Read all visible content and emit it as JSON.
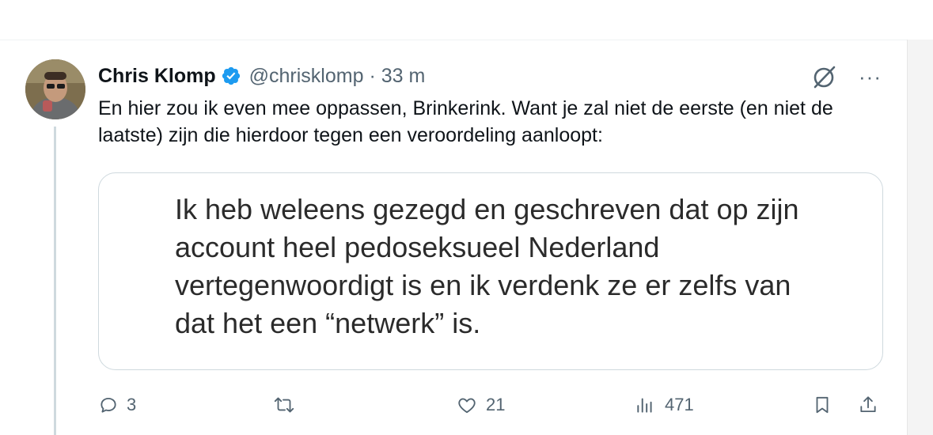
{
  "author": {
    "name": "Chris Klomp",
    "handle": "@chrisklomp",
    "separator": "·",
    "time": "33 m"
  },
  "tweet": {
    "text": "En hier zou ik even mee oppassen, Brinkerink. Want je zal niet de eerste (en niet de laatste) zijn die hierdoor tegen een veroordeling aanloopt:"
  },
  "quote": {
    "text": "Ik heb weleens gezegd en geschreven dat op zijn account heel pedoseksueel Nederland vertegenwoordigt is en ik verdenk ze er zelfs van dat het een “netwerk” is."
  },
  "actions": {
    "replies": "3",
    "reposts": "",
    "likes": "21",
    "views": "471"
  },
  "menu": {
    "more_label": "···"
  },
  "icons": [
    "verified-badge-icon",
    "grok-icon",
    "more-icon",
    "reply-icon",
    "repost-icon",
    "like-icon",
    "views-icon",
    "bookmark-icon",
    "share-icon"
  ],
  "colors": {
    "accent": "#1d9bf0",
    "muted": "#536471",
    "text": "#0f1419",
    "border": "#cfd9de"
  }
}
